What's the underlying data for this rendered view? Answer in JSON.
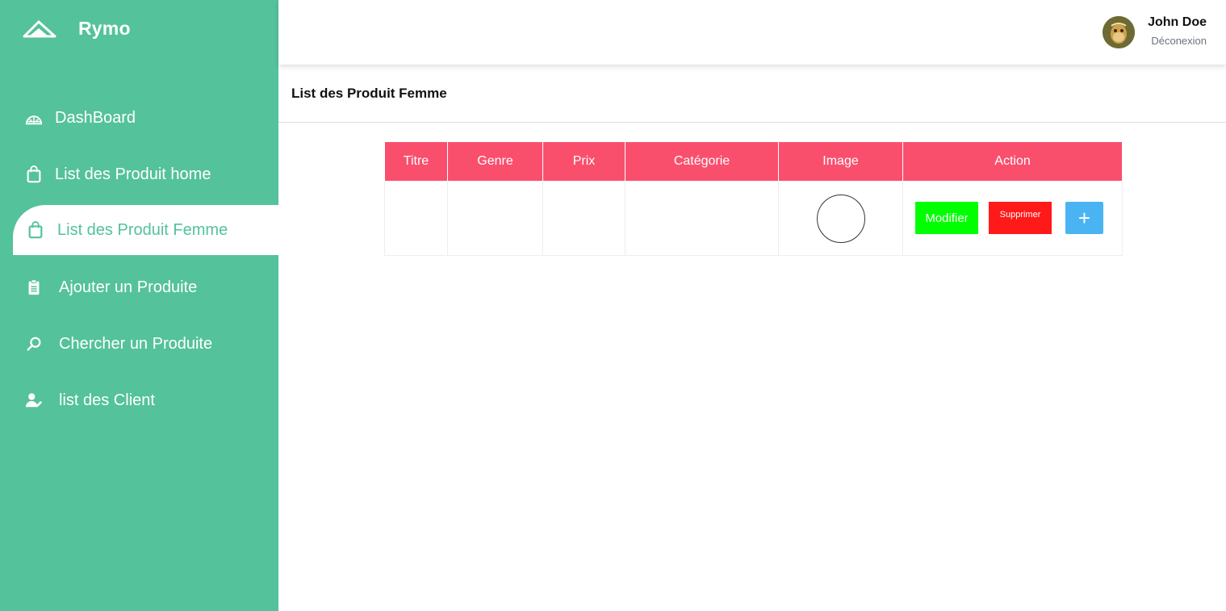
{
  "brand": {
    "name": "Rymo",
    "logo_icon": "paper-plane-icon"
  },
  "sidebar": {
    "items": [
      {
        "label": "DashBoard",
        "icon": "dashboard-icon"
      },
      {
        "label": "List des Produit home",
        "icon": "shopping-bag-icon"
      },
      {
        "label": "List des Produit Femme",
        "icon": "shopping-bag-icon",
        "active": true
      },
      {
        "label": "Ajouter un Produite",
        "icon": "clipboard-icon"
      },
      {
        "label": "Chercher un Produite",
        "icon": "search-icon"
      },
      {
        "label": "list des Client",
        "icon": "user-edit-icon"
      }
    ]
  },
  "header": {
    "user_name": "John Doe",
    "logout_label": "Déconexion",
    "avatar_icon": "avatar-image"
  },
  "page": {
    "title": "List des Produit Femme"
  },
  "table": {
    "columns": [
      "Titre",
      "Genre",
      "Prix",
      "Catégorie",
      "Image",
      "Action"
    ],
    "rows": [
      {
        "titre": "",
        "genre": "",
        "prix": "",
        "categorie": "",
        "image": ""
      }
    ],
    "actions": {
      "modifier_label": "Modifier",
      "supprimer_label": "Supprimer",
      "add_label": "+"
    }
  },
  "colors": {
    "sidebar": "#54c29b",
    "table_header": "#f94f6d",
    "modifier": "#00ff00",
    "supprimer": "#ff1a1a",
    "add": "#4ab4f3"
  }
}
